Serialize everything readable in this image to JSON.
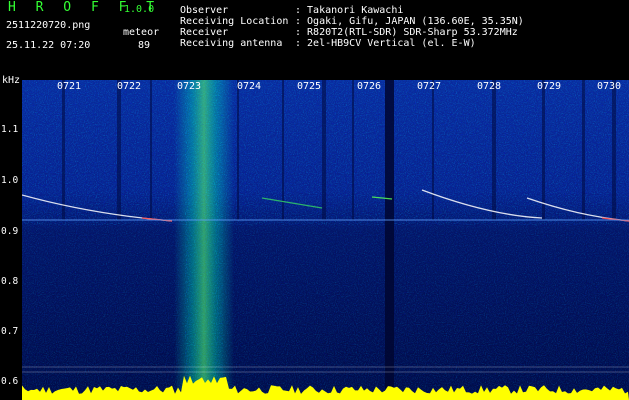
{
  "header": {
    "app_name": "H R O F F T",
    "version": "1.0.0",
    "file_name": "2511220720.png",
    "datetime": "25.11.22 07:20",
    "meteor_label": "meteor",
    "meteor_count": "89"
  },
  "station": {
    "rows": [
      {
        "label": "Observer",
        "value": ": Takanori Kawachi"
      },
      {
        "label": "Receiving Location",
        "value": ": Ogaki, Gifu, JAPAN (136.60E, 35.35N)"
      },
      {
        "label": "Receiver",
        "value": ": R820T2(RTL-SDR) SDR-Sharp 53.372MHz"
      },
      {
        "label": "Receiving antenna",
        "value": ": 2el-HB9CV Vertical (el. E-W)"
      }
    ]
  },
  "axis": {
    "unit": "kHz",
    "y_ticks": [
      "1.1",
      "1.0",
      "0.9",
      "0.8",
      "0.7",
      "0.6"
    ],
    "time_ticks": [
      "0721",
      "0722",
      "0723",
      "0724",
      "0725",
      "0726",
      "0727",
      "0728",
      "0729",
      "0730"
    ]
  },
  "colors": {
    "background": "#000000",
    "text": "#ffffff",
    "accent": "#33ff33",
    "spectrum_low": "#000050",
    "spectrum_high": "#00ffcc",
    "echo": "#ff4444",
    "amplitude": "#ffff00"
  }
}
